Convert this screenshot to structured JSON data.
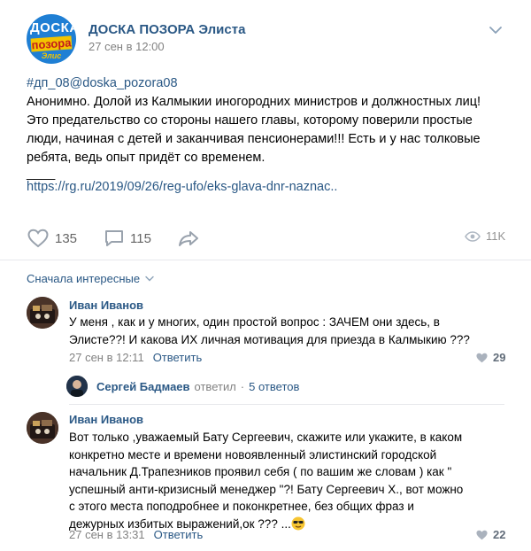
{
  "post": {
    "group_name": "ДОСКА ПОЗОРА Элиста",
    "avatar_text": {
      "top": "ДОСКА",
      "mid": "позора",
      "bot": "Элис"
    },
    "date": "27 сен в 12:00",
    "hashtag": "#дп_08@doska_pozora08",
    "text_lines": [
      "Анонимно. Долой из Калмыкии иногородних министров и должностных лиц!",
      "Это предательство со стороны нашего главы, которому поверили простые",
      "люди, начиная с детей и заканчивая пенсионерами!!! Есть и у нас толковые",
      "ребята, ведь опыт придёт со временем.",
      "____"
    ],
    "link": "https://rg.ru/2019/09/26/reg-ufo/eks-glava-dnr-naznac..",
    "likes": "135",
    "comments": "115",
    "views": "11K"
  },
  "comments_sort": "Сначала интересные",
  "comments": [
    {
      "author": "Иван Иванов",
      "lines": [
        " У меня , как и у многих, один простой вопрос : ЗАЧЕМ они здесь, в",
        "Элисте??! И какова ИХ личная мотивация для приезда в Калмыкию ???"
      ],
      "date": "27 сен в 12:11",
      "reply_label": "Ответить",
      "likes": "29"
    },
    {
      "author": "Иван Иванов",
      "lines": [
        "Вот только ,уважаемый Бату Сергеевич, скажите или укажите, в каком",
        "конкретно месте и времени новоявленный элистинский городской",
        "начальник Д.Трапезников проявил себя ( по вашим же словам ) как \"",
        "успешный анти-кризисный менеджер \"?! Бату Сергеевич Х., вот можно",
        "с этого места поподробнее и поконкретнее, без общих фраз и",
        "дежурных избитых выражений,ок ??? ..."
      ],
      "date": "27 сен в 13:31",
      "reply_label": "Ответить",
      "likes": "22"
    }
  ],
  "thread": {
    "name": "Сергей Бадмаев",
    "verb": "ответил",
    "separator": "·",
    "replies": "5 ответов"
  }
}
